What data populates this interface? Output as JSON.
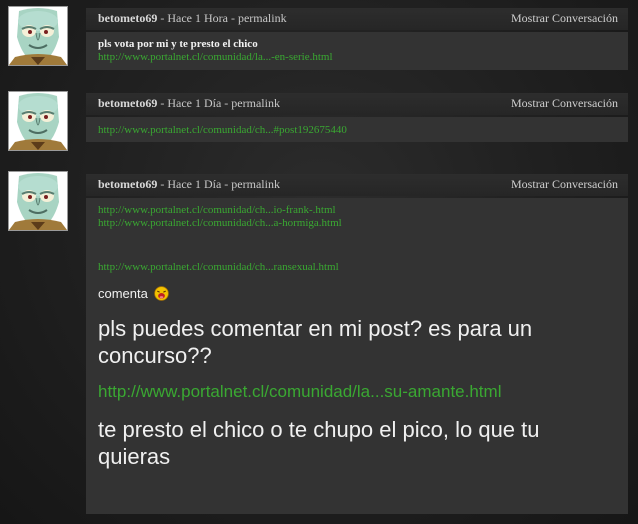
{
  "posts": [
    {
      "author": "betometo69",
      "time": " - Hace 1 Hora - ",
      "permalink": "permalink",
      "conversation": "Mostrar Conversación",
      "message": "pls vota por mi y te presto el chico",
      "link": "http://www.portalnet.cl/comunidad/la...-en-serie.html"
    },
    {
      "author": "betometo69",
      "time": " - Hace 1 Día - ",
      "permalink": "permalink",
      "conversation": "Mostrar Conversación",
      "link": "http://www.portalnet.cl/comunidad/ch...#post192675440"
    },
    {
      "author": "betometo69",
      "time": " - Hace 1 Día - ",
      "permalink": "permalink",
      "conversation": "Mostrar Conversación",
      "links": [
        "http://www.portalnet.cl/comunidad/ch...io-frank-.html",
        "http://www.portalnet.cl/comunidad/ch...a-hormiga.html",
        "http://www.portalnet.cl/comunidad/ch...ransexual.html"
      ],
      "comment_word": "comenta",
      "big_message_1": "pls puedes comentar en mi post? es para un concurso??",
      "big_link": "http://www.portalnet.cl/comunidad/la...su-amante.html",
      "big_message_2": "te presto el chico o te chupo el pico, lo que tu quieras"
    }
  ],
  "avatar_icon": "squidward-avatar-icon",
  "smiley_icon": "laughing-smiley-icon",
  "colors": {
    "link": "#3aa832",
    "post_bg": "#333333",
    "header_bg": "#2b2b2b"
  }
}
